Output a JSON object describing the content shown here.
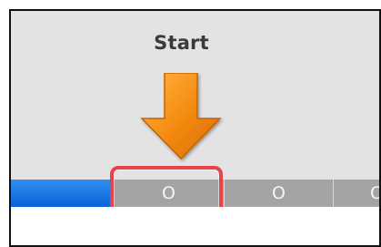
{
  "header": {
    "start_label": "Start"
  },
  "progress": {
    "completed_fraction": 0.27,
    "fill_color": "#1a74e4",
    "track_color": "#a4a4a4",
    "steps": [
      {
        "marker": "O"
      },
      {
        "marker": "O"
      },
      {
        "marker": "O"
      }
    ]
  },
  "callout": {
    "arrow_icon": "down-arrow-icon",
    "arrow_color": "#f08a10",
    "highlight_color": "#e8434b"
  }
}
